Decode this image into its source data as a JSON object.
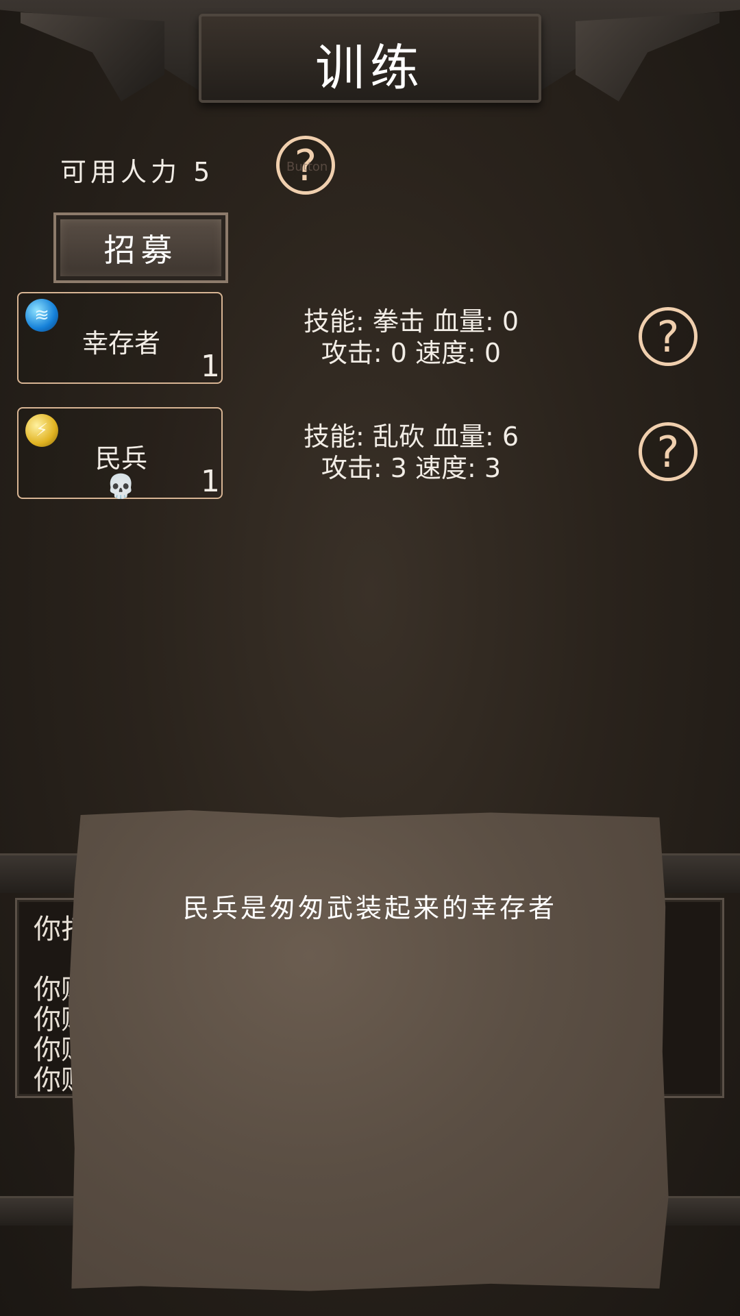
{
  "header": {
    "title": "训练"
  },
  "resources": {
    "manpower_label": "可用人力",
    "manpower_value": "5",
    "help_symbol": "?",
    "help_ghost_label": "Button"
  },
  "recruit": {
    "label": "招募"
  },
  "units": [
    {
      "name": "幸存者",
      "count": "1",
      "icon": "blue-claw-icon",
      "icon_color": "#1580d8",
      "stats_line1": "技能: 拳击 血量: 0",
      "stats_line2": "攻击: 0 速度: 0",
      "help_symbol": "?"
    },
    {
      "name": "民兵",
      "count": "1",
      "icon": "gold-slash-icon",
      "icon_color": "#e1b322",
      "status_icon": "skull-icon",
      "stats_line1": "技能: 乱砍 血量: 6",
      "stats_line2": "攻击: 3 速度: 3",
      "help_symbol": "?"
    }
  ],
  "log": {
    "lines": [
      "你打",
      "你购",
      "你购",
      "你购",
      "你购"
    ]
  },
  "dialog": {
    "text": "民兵是匆匆武装起来的幸存者"
  }
}
